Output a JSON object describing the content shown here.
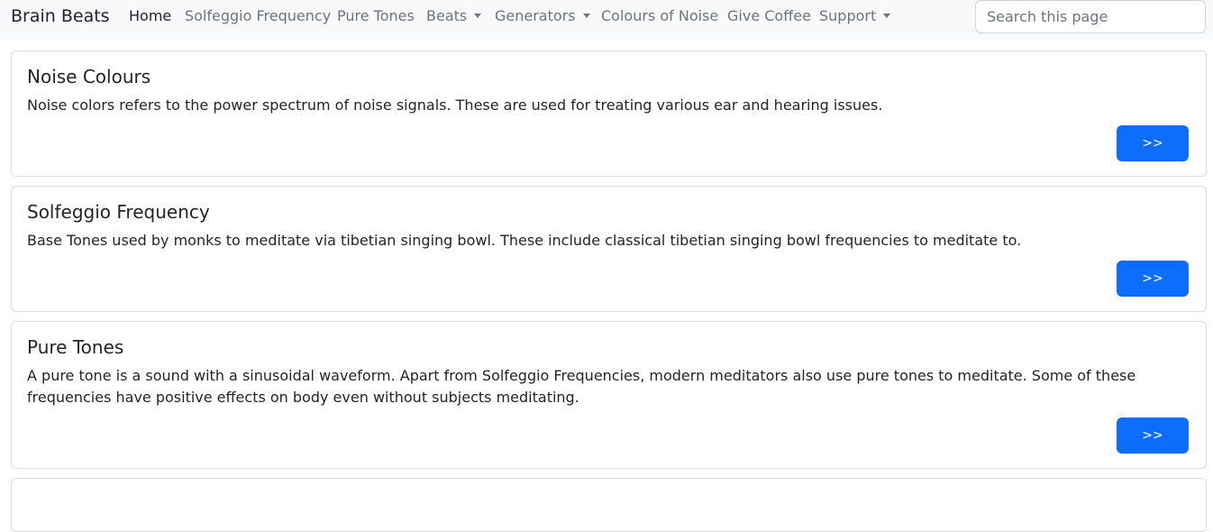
{
  "navbar": {
    "brand": "Brain Beats",
    "items": [
      {
        "label": "Home",
        "active": true,
        "dropdown": false
      },
      {
        "label": "Solfeggio Frequency",
        "active": false,
        "dropdown": false
      },
      {
        "label": "Pure Tones",
        "active": false,
        "dropdown": false
      },
      {
        "label": "Beats",
        "active": false,
        "dropdown": true
      },
      {
        "label": "Generators",
        "active": false,
        "dropdown": true
      },
      {
        "label": "Colours of Noise",
        "active": false,
        "dropdown": false
      },
      {
        "label": "Give Coffee",
        "active": false,
        "dropdown": false
      },
      {
        "label": "Support",
        "active": false,
        "dropdown": true
      }
    ],
    "search_placeholder": "Search this page"
  },
  "cards": [
    {
      "title": "Noise Colours",
      "text": "Noise colors refers to the power spectrum of noise signals. These are used for treating various ear and hearing issues.",
      "button_label": ">>"
    },
    {
      "title": "Solfeggio Frequency",
      "text": "Base Tones used by monks to meditate via tibetian singing bowl. These include classical tibetian singing bowl frequencies to meditate to.",
      "button_label": ">>"
    },
    {
      "title": "Pure Tones",
      "text": "A pure tone is a sound with a sinusoidal waveform. Apart from Solfeggio Frequencies, modern meditators also use pure tones to meditate. Some of these frequencies have positive effects on body even without subjects meditating.",
      "button_label": ">>"
    }
  ],
  "colors": {
    "navbar_bg": "#f8f9fa",
    "primary": "#0d6efd",
    "muted_link": "#6c757d",
    "text": "#212529"
  }
}
